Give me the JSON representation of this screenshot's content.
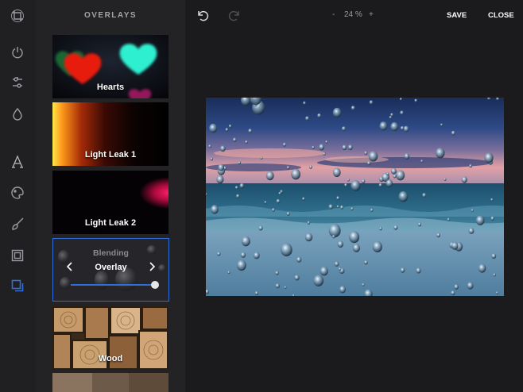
{
  "panel": {
    "title": "OVERLAYS",
    "items": [
      {
        "label": "Hearts"
      },
      {
        "label": "Light Leak 1"
      },
      {
        "label": "Light Leak 2"
      },
      {
        "label": "Wood"
      }
    ],
    "blending": {
      "heading": "Blending",
      "mode": "Overlay",
      "intensity": 1.0
    }
  },
  "topbar": {
    "zoom_out": "-",
    "zoom": "24 %",
    "zoom_in": "+",
    "save": "SAVE",
    "close": "CLOSE"
  },
  "rail": {
    "tools": [
      "crop-icon",
      "filters-icon",
      "adjust-icon",
      "drop-icon",
      "text-icon",
      "palette-icon",
      "brush-icon",
      "frame-icon",
      "overlay-icon"
    ],
    "active_tool": "overlay-icon",
    "accent": "#2f6fd9"
  }
}
